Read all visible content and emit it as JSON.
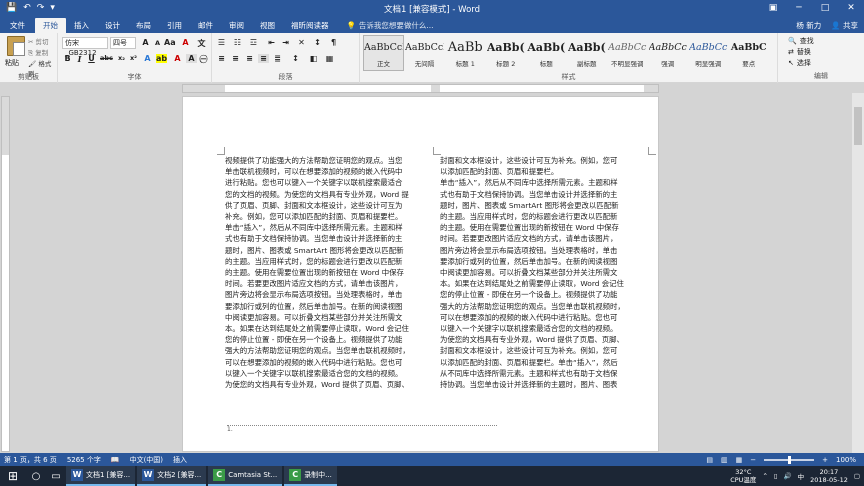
{
  "window": {
    "title": "文档1 [兼容模式] - Word"
  },
  "tabs": {
    "file": "文件",
    "start": "开始",
    "insert": "插入",
    "design": "设计",
    "layout": "布局",
    "references": "引用",
    "mailings": "邮件",
    "review": "审阅",
    "view": "视图",
    "foxit": "福昕阅读器",
    "tell_me": "告诉我您想要做什么...",
    "user": "杨 新力",
    "share": "共享"
  },
  "clipboard": {
    "paste": "粘贴",
    "cut": "剪切",
    "copy": "复制",
    "format_painter": "格式刷",
    "label": "剪贴板"
  },
  "font": {
    "name": "仿宋_GB2312",
    "size": "四号",
    "label": "字体"
  },
  "paragraph": {
    "label": "段落"
  },
  "styles": {
    "label": "样式",
    "items": [
      {
        "preview": "AaBbCcI",
        "name": "正文"
      },
      {
        "preview": "AaBbCcI",
        "name": "无间隔"
      },
      {
        "preview": "AaBb",
        "name": "标题 1"
      },
      {
        "preview": "AaBb(",
        "name": "标题 2"
      },
      {
        "preview": "AaBb(",
        "name": "标题"
      },
      {
        "preview": "AaBb(",
        "name": "副标题"
      },
      {
        "preview": "AaBbCc",
        "name": "不明显强调"
      },
      {
        "preview": "AaBbCc",
        "name": "强调"
      },
      {
        "preview": "AaBbCc",
        "name": "明显强调"
      },
      {
        "preview": "AaBbC",
        "name": "要点"
      }
    ]
  },
  "editing": {
    "find": "查找",
    "replace": "替换",
    "select": "选择",
    "label": "编辑"
  },
  "doc": {
    "col1": [
      "视频提供了功能强大的方法帮助您证明您的观点。当您",
      "单击联机视频时，可以在想要添加的视频的嵌入代码中",
      "进行粘贴。您也可以键入一个关键字以联机搜索最适合",
      "您的文档的视频。为使您的文档具有专业外观，Word 提",
      "供了页眉、页脚、封面和文本框设计，这些设计可互为",
      "补充。例如，您可以添加匹配的封面、页眉和提要栏。",
      "单击“插入”，然后从不同库中选择所需元素。主题和样",
      "式也有助于文档保持协调。当您单击设计并选择新的主",
      "题时，图片、图表或 SmartArt 图形将会更改以匹配新",
      "的主题。当应用样式时，您的标题会进行更改以匹配新",
      "的主题。使用在需要位置出现的新按钮在 Word 中保存",
      "时间。若要更改图片适应文档的方式，请单击该图片，",
      "图片旁边将会显示布局选项按钮。当处理表格时，单击",
      "要添加行或列的位置，然后单击加号。在新的阅读视图",
      "中阅读更加容易。可以折叠文档某些部分并关注所需文",
      "本。如果在达到结尾处之前需要停止读取，Word 会记住",
      "您的停止位置 - 即使在另一个设备上。视频提供了功能",
      "强大的方法帮助您证明您的观点。当您单击联机视频时，",
      "可以在想要添加的视频的嵌入代码中进行粘贴。您也可",
      "以键入一个关键字以联机搜索最适合您的文档的视频。",
      "为使您的文档具有专业外观，Word 提供了页眉、页脚、"
    ],
    "col2": [
      "封面和文本框设计，这些设计可互为补充。例如，您可",
      "以添加匹配的封面、页眉和提要栏。",
      "单击“插入”，然后从不同库中选择所需元素。主题和样",
      "式也有助于文档保持协调。当您单击设计并选择新的主",
      "题时，图片、图表或 SmartArt 图形将会更改以匹配新",
      "的主题。当应用样式时，您的标题会进行更改以匹配新",
      "的主题。使用在需要位置出现的新按钮在 Word 中保存",
      "时间。若要更改图片适应文档的方式，请单击该图片，",
      "图片旁边将会显示布局选项按钮。当处理表格时，单击",
      "要添加行或列的位置，然后单击加号。在新的阅读视图",
      "中阅读更加容易。可以折叠文档某些部分并关注所需文",
      "本。如果在达到结尾处之前需要停止读取，Word 会记住",
      "您的停止位置 - 即使在另一个设备上。视频提供了功能",
      "强大的方法帮助您证明您的观点。当您单击联机视频时，",
      "可以在想要添加的视频的嵌入代码中进行粘贴。您也可",
      "以键入一个关键字以联机搜索最适合您的文档的视频。",
      "为使您的文档具有专业外观，Word 提供了页眉、页脚、",
      "封面和文本框设计，这些设计可互为补充。例如，您可",
      "以添加匹配的封面、页眉和提要栏。单击“插入”，然后",
      "从不同库中选择所需元素。主题和样式也有助于文档保",
      "持协调。当您单击设计并选择新的主题时，图片、图表"
    ],
    "break_marker": "1."
  },
  "status": {
    "page": "第 1 页，共 6 页",
    "words": "5265 个字",
    "lang": "中文(中国)",
    "mode": "插入",
    "zoom": "100%"
  },
  "taskbar": {
    "items": [
      {
        "label": "文档1 [兼容...",
        "icon": "W"
      },
      {
        "label": "文档2 [兼容...",
        "icon": "W"
      },
      {
        "label": "Camtasia St...",
        "icon": "C"
      },
      {
        "label": "录制中...",
        "icon": "C"
      }
    ],
    "temp": "32°C",
    "cpu": "CPU温度",
    "time": "20:17",
    "date": "2018-05-12"
  }
}
